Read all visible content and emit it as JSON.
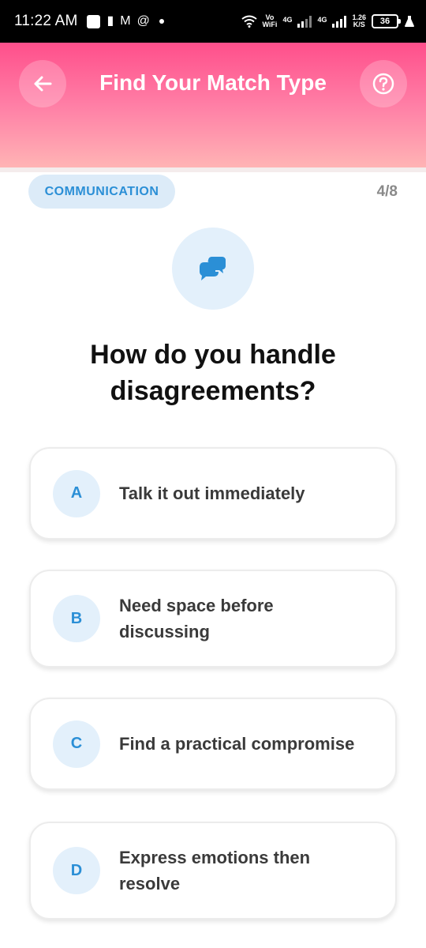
{
  "status_bar": {
    "time": "11:22 AM",
    "vo_top": "Vo",
    "vo_bottom": "WiFi",
    "sig1_label": "4G",
    "sig2_label": "4G",
    "speed_top": "1.26",
    "speed_bottom": "K/S",
    "battery": "36",
    "icons": [
      "notification-square-icon",
      "sim-icon",
      "gmail-icon",
      "threads-icon",
      "wifi-icon",
      "signal-icon",
      "battery-icon",
      "alert-icon"
    ]
  },
  "header": {
    "title": "Find Your Match Type",
    "back_icon": "arrow-left-icon",
    "help_icon": "question-circle-icon"
  },
  "quiz": {
    "category": "COMMUNICATION",
    "progress": "4/8",
    "question_icon": "chat-bubbles-icon",
    "question": "How do you handle disagreements?",
    "options": [
      {
        "letter": "A",
        "text": "Talk it out immediately"
      },
      {
        "letter": "B",
        "text": "Need space before\ndiscussing"
      },
      {
        "letter": "C",
        "text": "Find a practical compromise"
      },
      {
        "letter": "D",
        "text": "Express emotions then\nresolve"
      }
    ]
  },
  "colors": {
    "header_top": "#ff4f8b",
    "header_bottom": "#ffb5b5",
    "accent_blue": "#2b8fd6",
    "pill_bg": "#dcebf8"
  }
}
